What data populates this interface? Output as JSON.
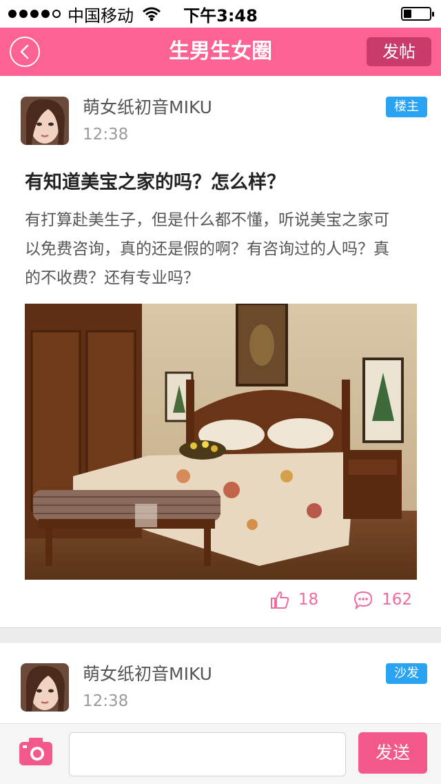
{
  "status_bar": {
    "carrier": "中国移动",
    "time": "下午3:48",
    "signal_bars_filled": 4,
    "signal_bars_total": 5,
    "battery_level": 0.3
  },
  "nav": {
    "title": "生男生女圈",
    "post_label": "发帖",
    "back_icon": "chevron-left-icon"
  },
  "post": {
    "author": "萌女纸初音MIKU",
    "time": "12:38",
    "badge": "楼主",
    "title": "有知道美宝之家的吗？怎么样？",
    "body": "有打算赴美生子，但是什么都不懂，听说美宝之家可以免费咨询，真的还是假的啊？有咨询过的人吗？真的不收费？还有专业吗？",
    "likes": "18",
    "comments": "162"
  },
  "reply": {
    "author": "萌女纸初音MIKU",
    "time": "12:38",
    "badge": "沙发"
  },
  "composer": {
    "input_value": "",
    "send_label": "发送",
    "camera_icon": "camera-icon"
  },
  "colors": {
    "brand_pink": "#fc6292",
    "badge_blue": "#2aa3f2"
  }
}
